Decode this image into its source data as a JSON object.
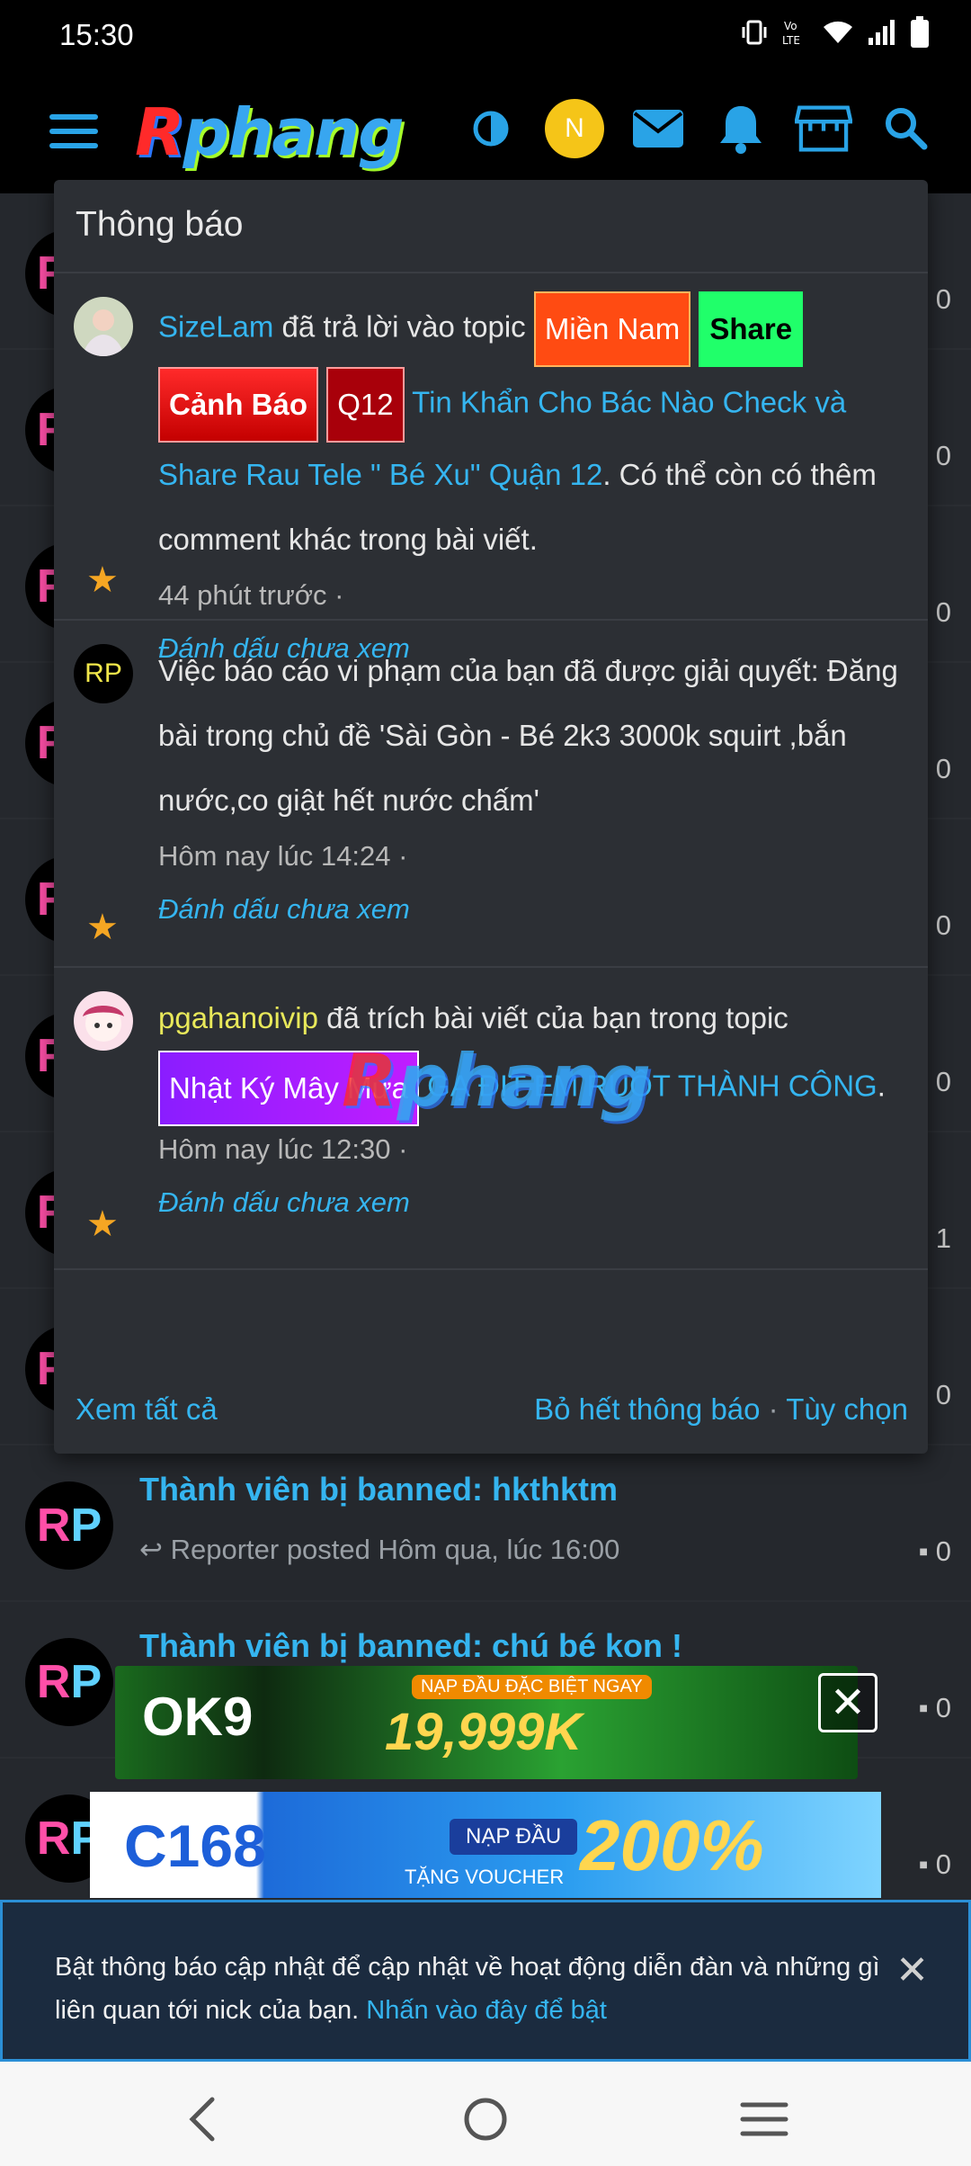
{
  "status": {
    "time": "15:30"
  },
  "app": {
    "logo_first": "R",
    "logo_rest": "phang",
    "avatar_letter": "N"
  },
  "threads": [
    {
      "title": "",
      "count": "0"
    },
    {
      "title": "",
      "count": "0"
    },
    {
      "title": "",
      "count": "0"
    },
    {
      "title": "",
      "count": "0"
    },
    {
      "title": "",
      "count": "0"
    },
    {
      "title": "",
      "count": "0"
    },
    {
      "title": "",
      "count": "1"
    },
    {
      "title": "",
      "count": "0"
    },
    {
      "title": "Thành viên bị banned: hkthktm",
      "meta": "Reporter posted Hôm qua, lúc 16:00",
      "count": "0"
    },
    {
      "title": "Thành viên bị banned: chú bé kon !",
      "meta": "",
      "count": "0"
    },
    {
      "title": "",
      "meta": "",
      "count": "0"
    }
  ],
  "popup": {
    "title": "Thông báo",
    "items": [
      {
        "user": "SizeLam",
        "action": " đã trả lời vào topic ",
        "tags": [
          "Miền Nam",
          "Share",
          "Cảnh Báo",
          "Q12"
        ],
        "topic": "Tin Khẩn Cho Bác Nào Check và Share Rau Tele \" Bé Xu\" Quận 12",
        "suffix": ". Có thể còn có thêm comment khác trong bài viết.",
        "time": "44 phút trước ·",
        "mark": "Đánh dấu chưa xem"
      },
      {
        "avatar": "RP",
        "message": "Việc báo cáo vi phạm của bạn đã được giải quyết: Đăng bài trong chủ đề 'Sài Gòn - Bé 2k3 3000k squirt ,bắn nước,co giật hết nước chấm'",
        "time": "Hôm nay lúc 14:24 ·",
        "mark": "Đánh dấu chưa xem"
      },
      {
        "user": "pgahanoivip",
        "action": " đã trích bài viết của bạn trong topic",
        "tags": [
          "Nhật Ký Mây Mưa"
        ],
        "topic": "GẠ ĐỊT EM RUỘT THÀNH CÔNG",
        "suffix": ".",
        "time": "Hôm nay lúc 12:30 ·",
        "mark": "Đánh dấu chưa xem"
      }
    ],
    "footer": {
      "see_all": "Xem tất cả",
      "dismiss_all": "Bỏ hết thông báo",
      "sep": " · ",
      "options": "Tùy chọn"
    }
  },
  "watermark": {
    "first": "R",
    "rest": "phang"
  },
  "ads": {
    "banner1": {
      "brand": "OK9",
      "badge": "NẠP ĐẦU ĐẶC BIỆT NGAY",
      "amount": "19,999K",
      "close": "✕"
    },
    "banner2": {
      "brand": "C168",
      "pill": "NẠP ĐẦU",
      "sub": "TẶNG VOUCHER",
      "percent": "200%"
    }
  },
  "notice": {
    "text": "Bật thông báo cập nhật để cập nhật về hoạt động diễn đàn và những gì liên quan tới nick của bạn. ",
    "link": "Nhấn vào đây để bật",
    "close": "✕"
  },
  "colors": {
    "accent": "#35b5f0",
    "star": "#f5a623",
    "background": "#25282d"
  }
}
